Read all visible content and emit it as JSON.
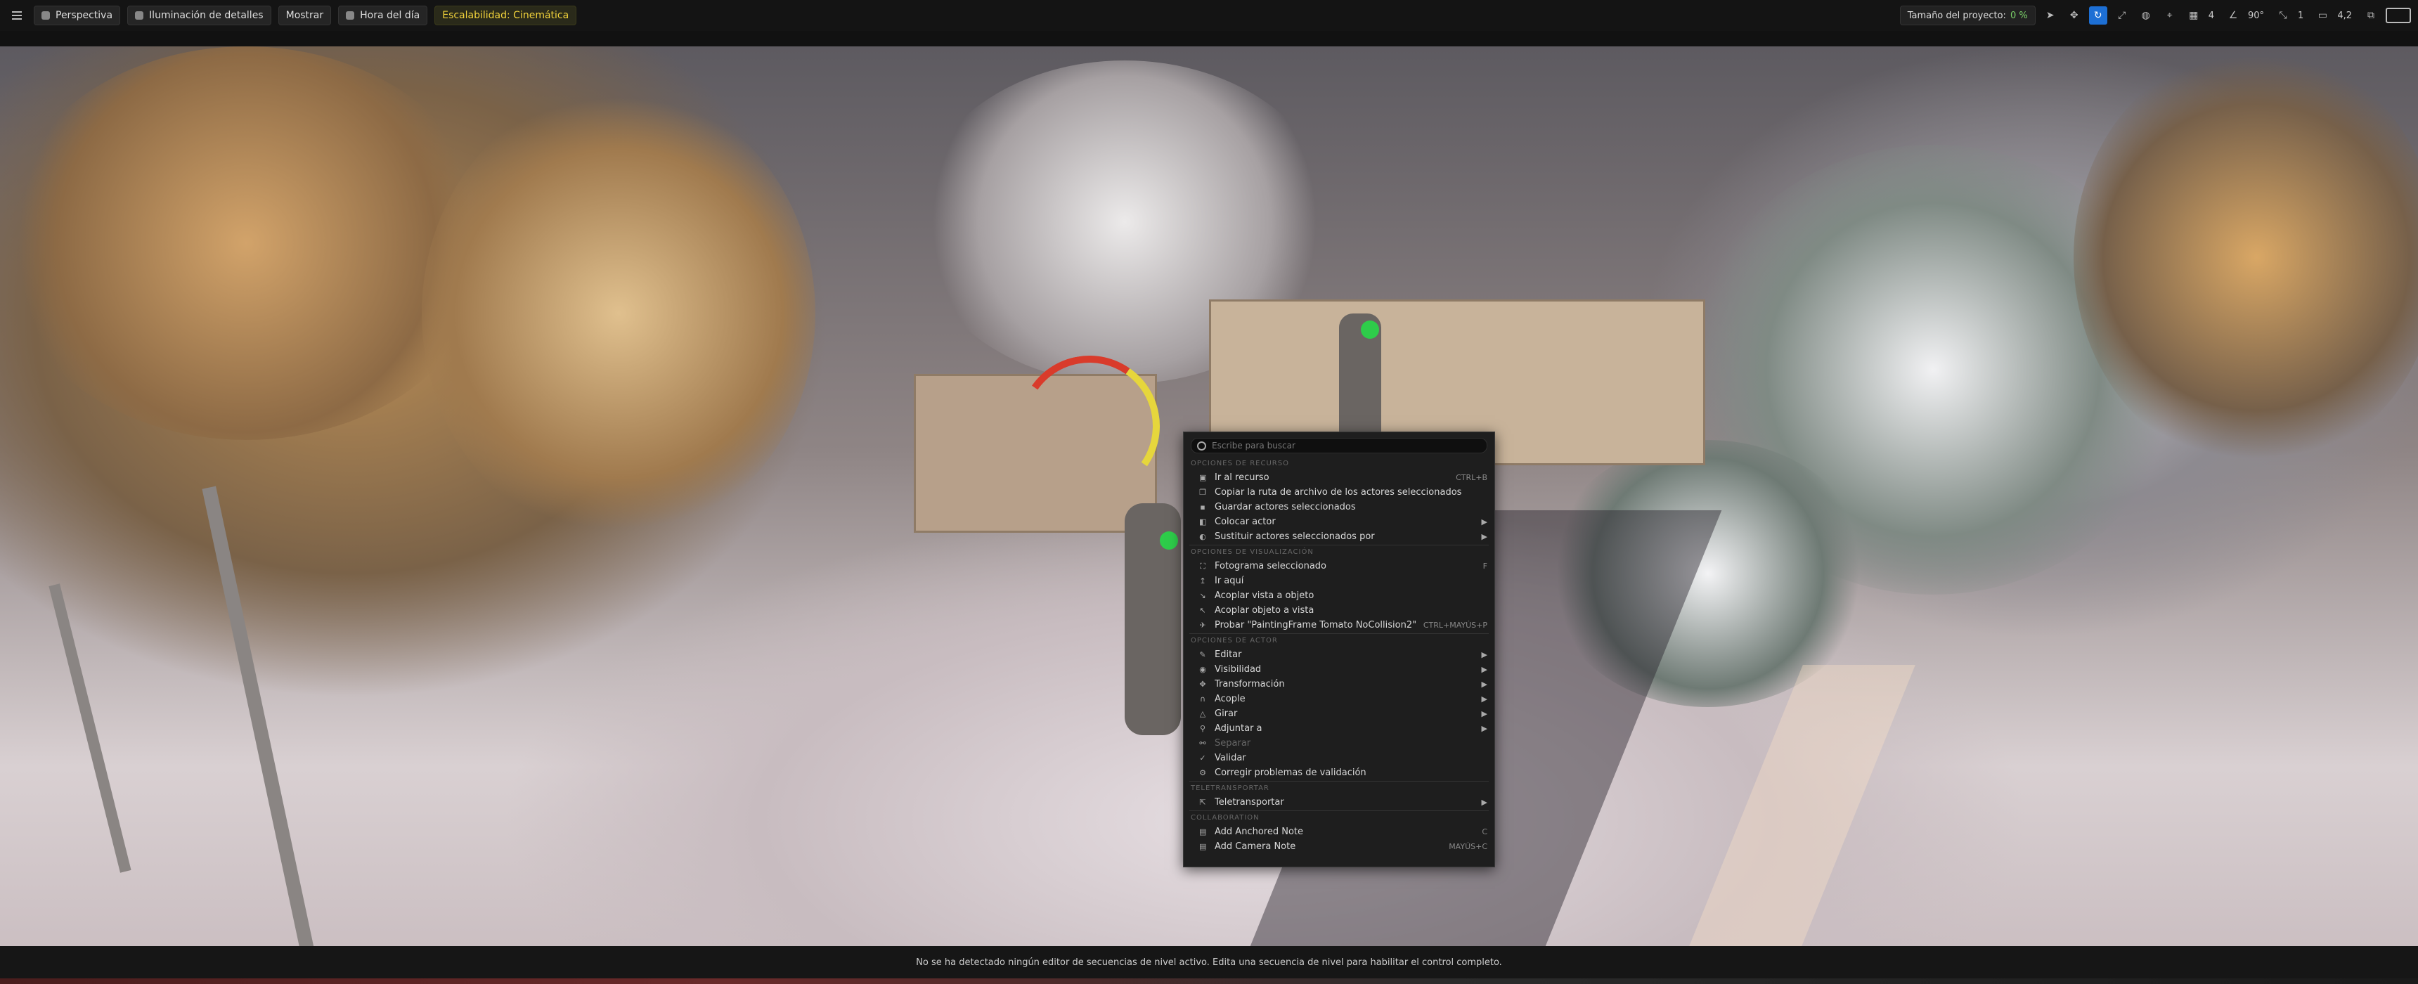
{
  "toolbar": {
    "perspective": "Perspectiva",
    "lighting": "Iluminación de detalles",
    "show": "Mostrar",
    "time_of_day": "Hora del día",
    "scalability": "Escalabilidad: Cinemática",
    "project_size_label": "Tamaño del proyecto:",
    "project_size_value": "0 %",
    "grid_value": "4",
    "angle_value": "90°",
    "scale_value": "1",
    "camera_speed": "4,2"
  },
  "context_menu": {
    "search_placeholder": "Escribe para buscar",
    "sections": {
      "resource": "Opciones de recurso",
      "view": "Opciones de visualización",
      "actor": "Opciones de actor",
      "teleport": "Teletransportar",
      "collab": "Collaboration"
    },
    "items": {
      "goto_resource": "Ir al recurso",
      "goto_resource_sc": "CTRL+B",
      "copy_path": "Copiar la ruta de archivo de los actores seleccionados",
      "save_actors": "Guardar actores seleccionados",
      "place_actor": "Colocar actor",
      "replace_actors": "Sustituir actores seleccionados por",
      "selected_frame": "Fotograma seleccionado",
      "selected_frame_sc": "F",
      "go_here": "Ir aquí",
      "snap_view": "Acoplar vista a objeto",
      "snap_object": "Acoplar objeto a vista",
      "pilot": "Probar \"PaintingFrame Tomato NoCollision2\"",
      "pilot_sc": "CTRL+MAYÚS+P",
      "edit": "Editar",
      "visibility": "Visibilidad",
      "transform": "Transformación",
      "snap": "Acople",
      "rotate": "Girar",
      "attach": "Adjuntar a",
      "detach": "Separar",
      "validate": "Validar",
      "fix_validation": "Corregir problemas de validación",
      "teleport": "Teletransportar",
      "anchored_note": "Add Anchored Note",
      "anchored_note_sc": "C",
      "camera_note": "Add Camera Note",
      "camera_note_sc": "MAYÚS+C"
    }
  },
  "status": {
    "message": "No se ha detectado ningún editor de secuencias de nivel activo. Edita una secuencia de nivel para habilitar el control completo."
  }
}
